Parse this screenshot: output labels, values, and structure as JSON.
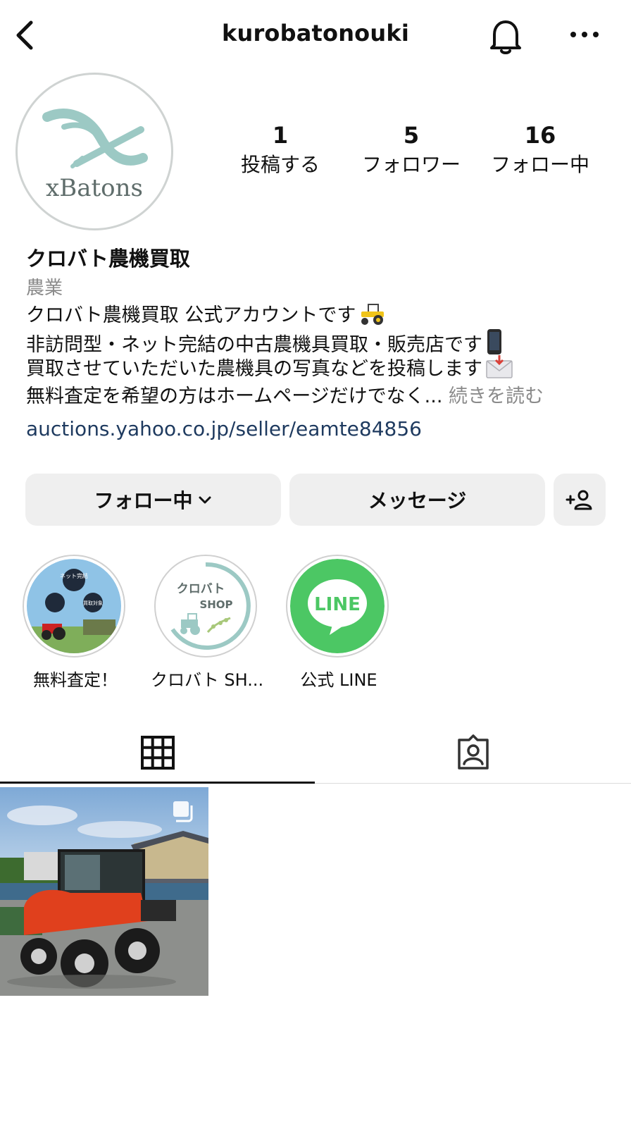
{
  "header": {
    "username": "kurobatonouki",
    "back_icon": "chevron-left-icon",
    "bell_icon": "bell-icon",
    "more_icon": "more-horizontal-icon"
  },
  "avatar": {
    "logo_text": "xBatons",
    "accent": "#9cc9c4"
  },
  "stats": {
    "posts": {
      "value": "1",
      "label": "投稿する"
    },
    "followers": {
      "value": "5",
      "label": "フォロワー"
    },
    "following": {
      "value": "16",
      "label": "フォロー中"
    }
  },
  "bio": {
    "name": "クロバト農機買取",
    "category": "農業",
    "line1": "クロバト農機買取 公式アカウントです",
    "line2": "非訪問型・ネット完結の中古農機具買取・販売店です",
    "line3": "買取させていただいた農機具の写真などを投稿します",
    "line4": "無料査定を希望の方はホームページだけでなく...",
    "more": "続きを読む",
    "link": "auctions.yahoo.co.jp/seller/eamte84856"
  },
  "buttons": {
    "following": "フォロー中",
    "message": "メッセージ",
    "add_user_icon": "add-user-icon"
  },
  "highlights": [
    {
      "label": "無料査定！",
      "art_texts": [
        "ネット完結",
        "買取対象"
      ]
    },
    {
      "label": "クロバト SH...",
      "art_texts": [
        "クロバト",
        "SHOP"
      ]
    },
    {
      "label": "公式 LINE",
      "art_texts": [
        "LINE"
      ]
    }
  ],
  "tabs": {
    "grid_icon": "grid-icon",
    "tagged_icon": "tagged-person-icon"
  },
  "colors": {
    "link": "#1e3a5f",
    "line_green": "#4cc764",
    "button_bg": "#efefef",
    "tractor": "#e0401d"
  }
}
